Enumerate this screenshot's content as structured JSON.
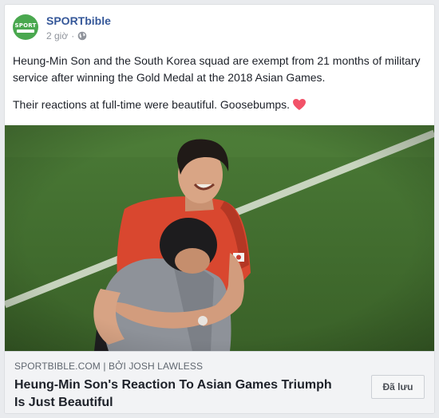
{
  "post": {
    "page_name": "SPORTbible",
    "avatar_text": "SPORT",
    "time": "2 giờ",
    "separator": "·",
    "privacy_icon": "globe-icon",
    "text_line1": "Heung-Min Son and the South Korea squad are exempt from 21 months of military service after winning the Gold Medal at the 2018 Asian Games.",
    "text_line2": "Their reactions at full-time were beautiful. Goosebumps.",
    "emoji": "heart-icon"
  },
  "link": {
    "domain": "SPORTBIBLE.COM",
    "divider": "|",
    "author": "BỞI JOSH LAWLESS",
    "title": "Heung-Min Son's Reaction To Asian Games Triumph Is Just Beautiful",
    "save_label": "Đã lưu"
  },
  "colors": {
    "page_name": "#365899",
    "avatar": "#4aa84f",
    "heart": "#f25268",
    "pitch": "#3f6b2d"
  }
}
